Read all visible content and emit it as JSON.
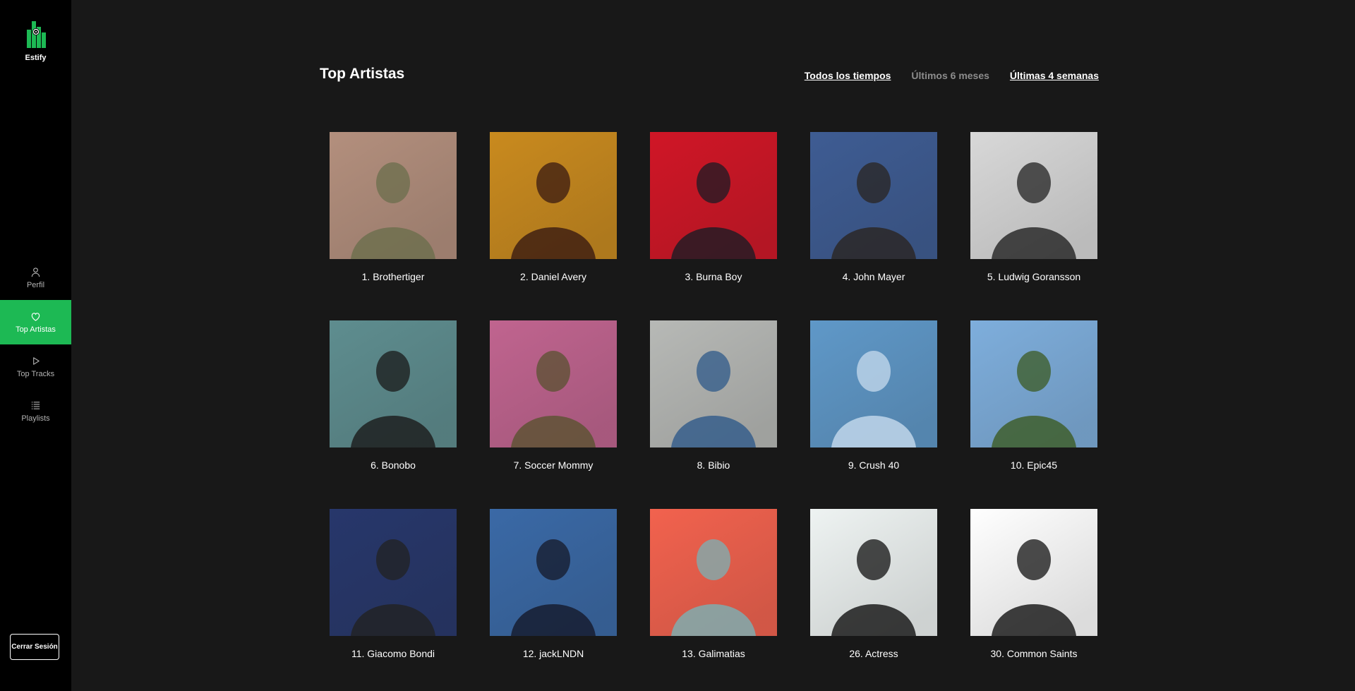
{
  "app": {
    "name": "Estify"
  },
  "sidebar": {
    "items": [
      {
        "label": "Perfil",
        "icon": "user-icon"
      },
      {
        "label": "Top Artistas",
        "icon": "heart-icon",
        "active": true
      },
      {
        "label": "Top Tracks",
        "icon": "play-icon"
      },
      {
        "label": "Playlists",
        "icon": "list-icon"
      }
    ],
    "logout_label": "Cerrar Sesión"
  },
  "main": {
    "title": "Top Artistas",
    "ranges": [
      {
        "label": "Todos los tiempos",
        "state": "underlined"
      },
      {
        "label": "Últimos 6 meses",
        "state": "dim"
      },
      {
        "label": "Últimas 4 semanas",
        "state": "underlined"
      }
    ],
    "artists": [
      {
        "caption": "1. Brothertiger",
        "colors": [
          "#b38f7d",
          "#6b6e4c"
        ]
      },
      {
        "caption": "2. Daniel Avery",
        "colors": [
          "#c98a1e",
          "#3a1a12"
        ]
      },
      {
        "caption": "3. Burna Boy",
        "colors": [
          "#d01626",
          "#1b1b24"
        ]
      },
      {
        "caption": "4. John Mayer",
        "colors": [
          "#3e5c93",
          "#2a2420"
        ]
      },
      {
        "caption": "5. Ludwig Goransson",
        "colors": [
          "#d8d8d8",
          "#222222"
        ]
      },
      {
        "caption": "6. Bonobo",
        "colors": [
          "#5e8d8f",
          "#1a1a1a"
        ]
      },
      {
        "caption": "7. Soccer Mommy",
        "colors": [
          "#c0648f",
          "#5a5230"
        ]
      },
      {
        "caption": "8. Bibio",
        "colors": [
          "#b7b9b6",
          "#2f5a8a"
        ]
      },
      {
        "caption": "9. Crush 40",
        "colors": [
          "#5f98c8",
          "#c7dbee"
        ]
      },
      {
        "caption": "10. Epic45",
        "colors": [
          "#7eaedc",
          "#3c5b23"
        ]
      },
      {
        "caption": "11. Giacomo Bondi",
        "colors": [
          "#27376b",
          "#222222"
        ]
      },
      {
        "caption": "12. jackLNDN",
        "colors": [
          "#3a69a6",
          "#15192a"
        ]
      },
      {
        "caption": "13. Galimatias",
        "colors": [
          "#f2624e",
          "#79b2b5"
        ]
      },
      {
        "caption": "26. Actress",
        "colors": [
          "#eef3f2",
          "#101010"
        ]
      },
      {
        "caption": "30. Common Saints",
        "colors": [
          "#ffffff",
          "#111111"
        ]
      }
    ]
  }
}
